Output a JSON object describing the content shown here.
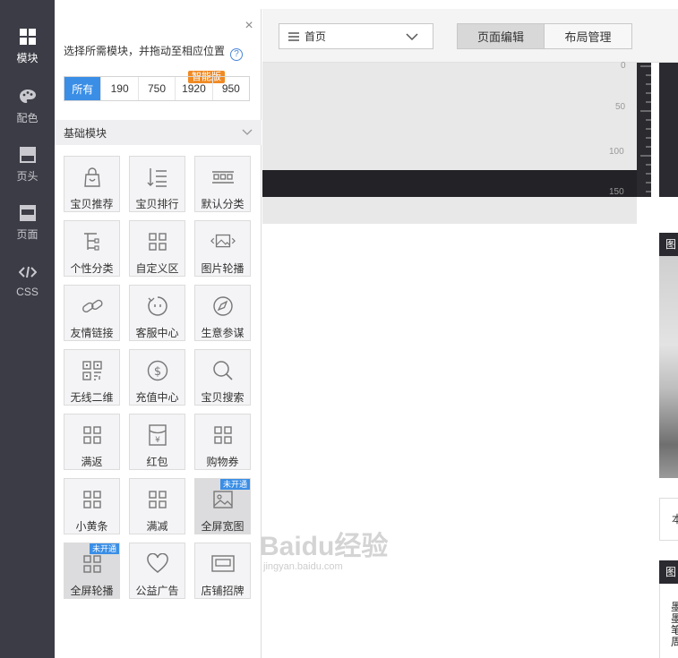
{
  "leftnav": {
    "items": [
      {
        "label": "模块",
        "icon": "grid-icon",
        "active": true
      },
      {
        "label": "配色",
        "icon": "palette-icon",
        "active": false
      },
      {
        "label": "页头",
        "icon": "header-icon",
        "active": false
      },
      {
        "label": "页面",
        "icon": "page-icon",
        "active": false
      },
      {
        "label": "CSS",
        "icon": "code-icon",
        "active": false
      }
    ]
  },
  "panel": {
    "close_label": "×",
    "tip": "选择所需模块，并拖动至相应位置",
    "help": "?",
    "width_tabs": [
      "所有",
      "190",
      "750",
      "1920",
      "950"
    ],
    "smart_badge": "智能版",
    "section_title": "基础模块",
    "modules": [
      {
        "label": "宝贝推荐",
        "icon": "bag-icon"
      },
      {
        "label": "宝贝排行",
        "icon": "sort-list-icon"
      },
      {
        "label": "默认分类",
        "icon": "category-icon"
      },
      {
        "label": "个性分类",
        "icon": "tree-icon"
      },
      {
        "label": "自定义区",
        "icon": "grid-icon"
      },
      {
        "label": "图片轮播",
        "icon": "image-carousel-icon"
      },
      {
        "label": "友情链接",
        "icon": "link-icon"
      },
      {
        "label": "客服中心",
        "icon": "service-icon"
      },
      {
        "label": "生意参谋",
        "icon": "compass-icon"
      },
      {
        "label": "无线二维",
        "icon": "qrcode-icon"
      },
      {
        "label": "充值中心",
        "icon": "dollar-icon"
      },
      {
        "label": "宝贝搜索",
        "icon": "search-icon"
      },
      {
        "label": "满返",
        "icon": "grid-icon"
      },
      {
        "label": "红包",
        "icon": "red-envelope-icon"
      },
      {
        "label": "购物券",
        "icon": "grid-icon"
      },
      {
        "label": "小黄条",
        "icon": "grid-icon"
      },
      {
        "label": "满减",
        "icon": "grid-icon"
      },
      {
        "label": "全屏宽图",
        "icon": "image-icon",
        "tag": "未开通"
      },
      {
        "label": "全屏轮播",
        "icon": "grid-icon",
        "tag": "未开通"
      },
      {
        "label": "公益广告",
        "icon": "heart-icon"
      },
      {
        "label": "店铺招牌",
        "icon": "signboard-icon"
      }
    ]
  },
  "topbar": {
    "page_select_value": "首页",
    "tabs": [
      "页面编辑",
      "布局管理"
    ]
  },
  "canvas": {
    "ruler_labels": [
      "0",
      "50",
      "100",
      "150"
    ],
    "right_head_1": "图",
    "right_box": "本",
    "right_head_2": "图",
    "right_text": "墨墨笔周"
  },
  "watermark": {
    "text": "Baidu经验",
    "sub": "jingyan.baidu.com"
  },
  "colors": {
    "nav_bg": "#3c3c46",
    "accent": "#3a8ee6",
    "badge": "#f08a24"
  }
}
